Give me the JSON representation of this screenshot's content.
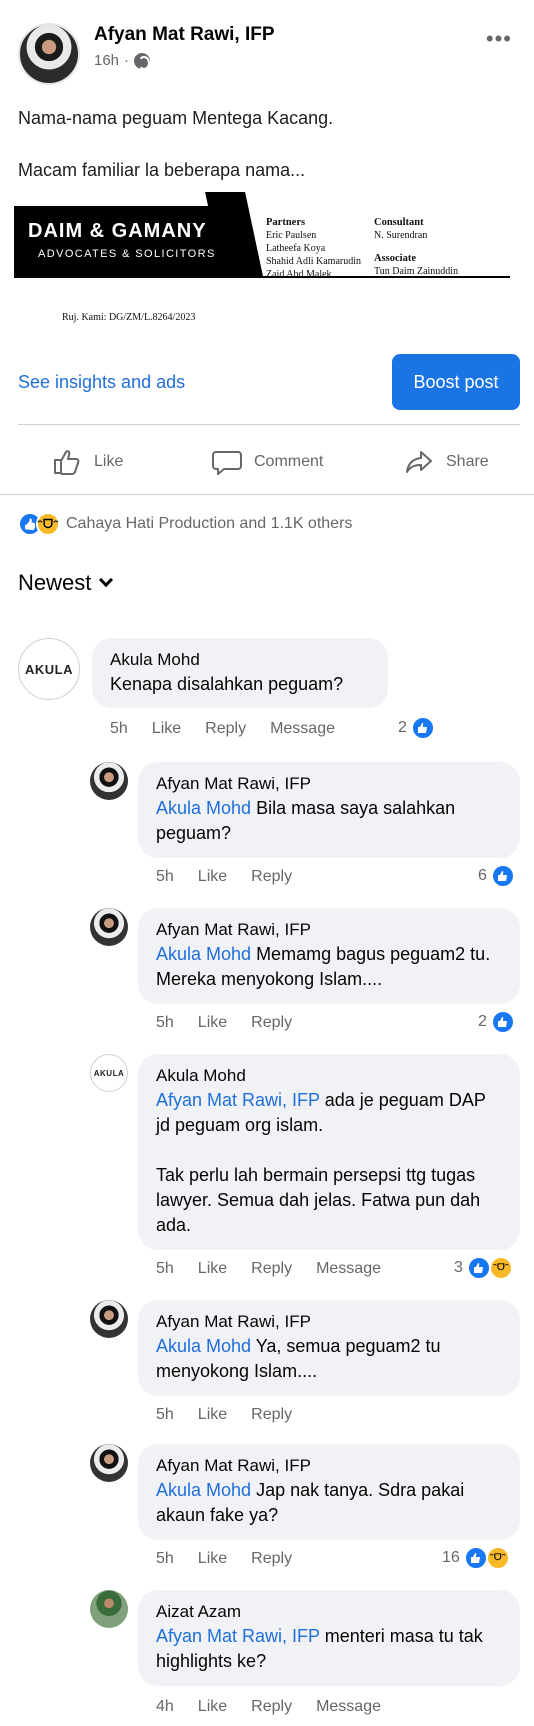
{
  "post": {
    "author": "Afyan Mat Rawi, IFP",
    "time": "16h",
    "caption_line1": "Nama-nama peguam Mentega Kacang.",
    "caption_line2": "Macam familiar la beberapa nama...",
    "letterhead": {
      "firm": "DAIM & GAMANY",
      "subtitle": "ADVOCATES & SOLICITORS",
      "partners_heading": "Partners",
      "partners": [
        "Eric Paulsen",
        "Latheefa Koya",
        "Shahid Adli Kamarudin",
        "Zaid Abd Malek"
      ],
      "consultant_heading": "Consultant",
      "consultant": "N. Surendran",
      "associate_heading": "Associate",
      "associate": "Tun Daim Zainuddin",
      "reference": "Ruj. Kami: DG/ZM/L.8264/2023"
    },
    "insights_link": "See insights and ads",
    "boost_label": "Boost post",
    "actions": {
      "like": "Like",
      "comment": "Comment",
      "share": "Share"
    },
    "reactions_text": "Cahaya Hati Production and 1.1K others"
  },
  "sort_label": "Newest",
  "comments": [
    {
      "name": "Akula Mohd",
      "text": "Kenapa disalahkan peguam?",
      "time": "5h",
      "like": "Like",
      "reply": "Reply",
      "message": "Message",
      "count": "2"
    },
    {
      "name": "Afyan Mat Rawi, IFP",
      "mention": "Akula Mohd",
      "text": " Bila masa saya salahkan peguam?",
      "time": "5h",
      "like": "Like",
      "reply": "Reply",
      "count": "6"
    },
    {
      "name": "Afyan Mat Rawi, IFP",
      "mention": "Akula Mohd",
      "text": " Memamg bagus peguam2 tu. Mereka menyokong Islam....",
      "time": "5h",
      "like": "Like",
      "reply": "Reply",
      "count": "2"
    },
    {
      "name": "Akula Mohd",
      "mention": "Afyan Mat Rawi, IFP",
      "text": " ada je peguam DAP jd peguam org islam.",
      "text2": "Tak perlu lah bermain persepsi ttg tugas lawyer. Semua dah jelas. Fatwa pun dah ada.",
      "time": "5h",
      "like": "Like",
      "reply": "Reply",
      "message": "Message",
      "count": "3"
    },
    {
      "name": "Afyan Mat Rawi, IFP",
      "mention": "Akula Mohd",
      "text": " Ya, semua peguam2 tu menyokong Islam....",
      "time": "5h",
      "like": "Like",
      "reply": "Reply"
    },
    {
      "name": "Afyan Mat Rawi, IFP",
      "mention": "Akula Mohd",
      "text": " Jap nak tanya. Sdra pakai akaun fake ya?",
      "time": "5h",
      "like": "Like",
      "reply": "Reply",
      "count": "16"
    },
    {
      "name": "Aizat Azam",
      "mention": "Afyan Mat Rawi, IFP",
      "text": " menteri masa tu tak highlights ke?",
      "time": "4h",
      "like": "Like",
      "reply": "Reply",
      "message": "Message"
    }
  ],
  "avatar_text": {
    "akula": "AKULA"
  },
  "colors": {
    "link_blue": "#216fdb",
    "button_blue": "#1b74e4",
    "like_blue": "#1877f2",
    "haha_yellow": "#f7b928",
    "bubble_gray": "#f0f2f5"
  },
  "icons": [
    "globe-icon",
    "more-icon",
    "thumbs-up-icon",
    "comment-icon",
    "share-icon",
    "chevron-down-icon",
    "like-reaction-icon",
    "haha-reaction-icon"
  ]
}
